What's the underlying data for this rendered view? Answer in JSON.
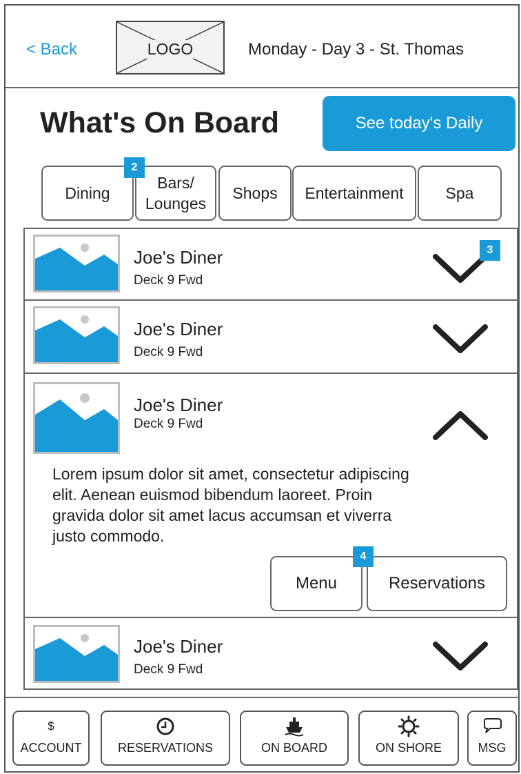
{
  "header": {
    "back_label": "< Back",
    "logo_label": "LOGO",
    "day_label": "Monday - Day 3 - St. Thomas"
  },
  "title": "What's On Board",
  "daily_button": "See today's Daily",
  "tabs": [
    {
      "label": "Dining"
    },
    {
      "label_line1": "Bars/",
      "label_line2": "Lounges"
    },
    {
      "label": "Shops"
    },
    {
      "label": "Entertainment"
    },
    {
      "label": "Spa"
    }
  ],
  "badges": [
    "2",
    "3",
    "4"
  ],
  "items": [
    {
      "name": "Joe's Diner",
      "location": "Deck 9 Fwd",
      "expanded": false
    },
    {
      "name": "Joe's Diner",
      "location": "Deck 9 Fwd",
      "expanded": false
    },
    {
      "name": "Joe's Diner",
      "location": "Deck 9 Fwd",
      "expanded": true,
      "description_lines": [
        "Lorem ipsum dolor sit amet, consectetur adipiscing",
        "elit. Aenean euismod bibendum laoreet. Proin",
        "gravida dolor sit amet lacus accumsan et viverra",
        "justo commodo."
      ],
      "menu_label": "Menu",
      "reservations_label": "Reservations"
    },
    {
      "name": "Joe's Diner",
      "location": "Deck 9 Fwd",
      "expanded": false
    }
  ],
  "bottom_nav": [
    {
      "icon_text": "$",
      "label": "ACCOUNT",
      "icon": "dollar-icon"
    },
    {
      "label": "RESERVATIONS",
      "icon": "clock-icon"
    },
    {
      "label": "ON BOARD",
      "icon": "ship-icon"
    },
    {
      "label": "ON SHORE",
      "icon": "sun-icon"
    },
    {
      "label": "MSG",
      "icon": "chat-bubble-icon"
    }
  ],
  "colors": {
    "accent": "#1a9ad6",
    "image_placeholder": "#1a9ad6",
    "border": "#666666"
  }
}
